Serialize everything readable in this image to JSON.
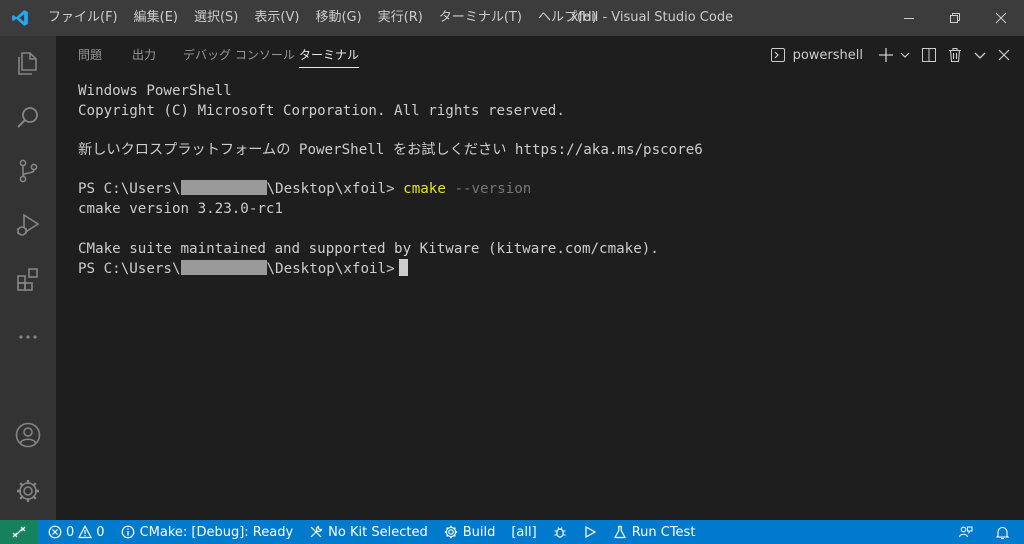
{
  "window": {
    "title": "xfoil - Visual Studio Code"
  },
  "menu": [
    {
      "label": "ファイル(F)"
    },
    {
      "label": "編集(E)"
    },
    {
      "label": "選択(S)"
    },
    {
      "label": "表示(V)"
    },
    {
      "label": "移動(G)"
    },
    {
      "label": "実行(R)"
    },
    {
      "label": "ターミナル(T)"
    },
    {
      "label": "ヘルプ(H)"
    }
  ],
  "activity_bar": [
    "files-icon",
    "search-icon",
    "source-control-icon",
    "run-debug-icon",
    "extensions-icon",
    "more-icon",
    "accounts-icon",
    "manage-gear-icon"
  ],
  "panel": {
    "tabs": [
      {
        "label": "問題",
        "active": false
      },
      {
        "label": "出力",
        "active": false
      },
      {
        "label": "デバッグ コンソール",
        "active": false
      },
      {
        "label": "ターミナル",
        "active": true
      }
    ],
    "terminal_selector": "powershell"
  },
  "terminal": {
    "header1": "Windows PowerShell",
    "header2": "Copyright (C) Microsoft Corporation. All rights reserved.",
    "notice": "新しいクロスプラットフォームの PowerShell をお試しください https://aka.ms/pscore6",
    "prompt_prefix": "PS C:\\Users\\",
    "prompt_suffix": "\\Desktop\\xfoil>",
    "command": "cmake",
    "command_arg": "--version",
    "output1": "cmake version 3.23.0-rc1",
    "output2": "CMake suite maintained and supported by Kitware (kitware.com/cmake)."
  },
  "status": {
    "errors": "0",
    "warnings": "0",
    "cmake_status": "CMake: [Debug]: Ready",
    "kit": "No Kit Selected",
    "build": "Build",
    "target": "[all]",
    "ctest": "Run CTest"
  },
  "colors": {
    "titlebar": "#3c3c3c",
    "activitybar": "#333333",
    "editor_bg": "#1e1e1e",
    "statusbar": "#007acc",
    "remote": "#16825d",
    "command": "#e5e510",
    "vscode_blue": "#23a9f2"
  }
}
